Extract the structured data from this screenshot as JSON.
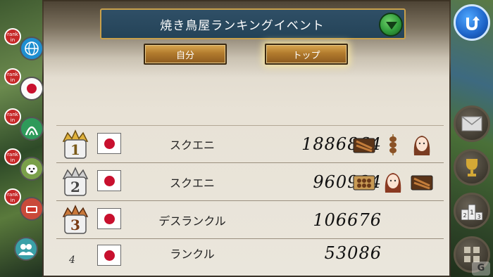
{
  "event": {
    "title": "焼き鳥屋ランキングイベント",
    "tabs": [
      {
        "label": "自分",
        "active": false
      },
      {
        "label": "トップ",
        "active": true
      }
    ]
  },
  "leaderboard": [
    {
      "rank": "1",
      "player": "スクエニ",
      "score": "1886864",
      "country": "japan",
      "items": [
        "grill-plate",
        "skewer",
        "character-portrait"
      ]
    },
    {
      "rank": "2",
      "player": "スクエニ",
      "score": "960934",
      "country": "japan",
      "items": [
        "tray",
        "character-portrait",
        "grill-plate"
      ]
    },
    {
      "rank": "3",
      "player": "デスランクル",
      "score": "106676",
      "country": "japan",
      "items": []
    },
    {
      "rank": "4",
      "player": "ランクル",
      "score": "53086",
      "country": "japan",
      "items": []
    }
  ],
  "left_rank_icons": [
    {
      "tag": "rank in",
      "icon": "globe-icon"
    },
    {
      "tag": "rank in",
      "icon": "japan-flag-icon"
    },
    {
      "tag": "rank in",
      "icon": "arch-icon"
    },
    {
      "tag": "rank in",
      "icon": "dog-icon"
    },
    {
      "tag": "rank in",
      "icon": "food-icon"
    },
    {
      "tag": "",
      "icon": "friends-icon"
    }
  ],
  "right_icons": [
    "undo-icon",
    "mail-icon",
    "trophy-icon",
    "podium-icon",
    "grid-icon"
  ],
  "podium_digits": [
    "1",
    "2",
    "3"
  ],
  "colors": {
    "title_bg": "#2f4f66",
    "tab_gold": "#b27b2d",
    "rank_tag_red": "#c62828",
    "japan_red": "#c8102e"
  },
  "watermark": "G"
}
